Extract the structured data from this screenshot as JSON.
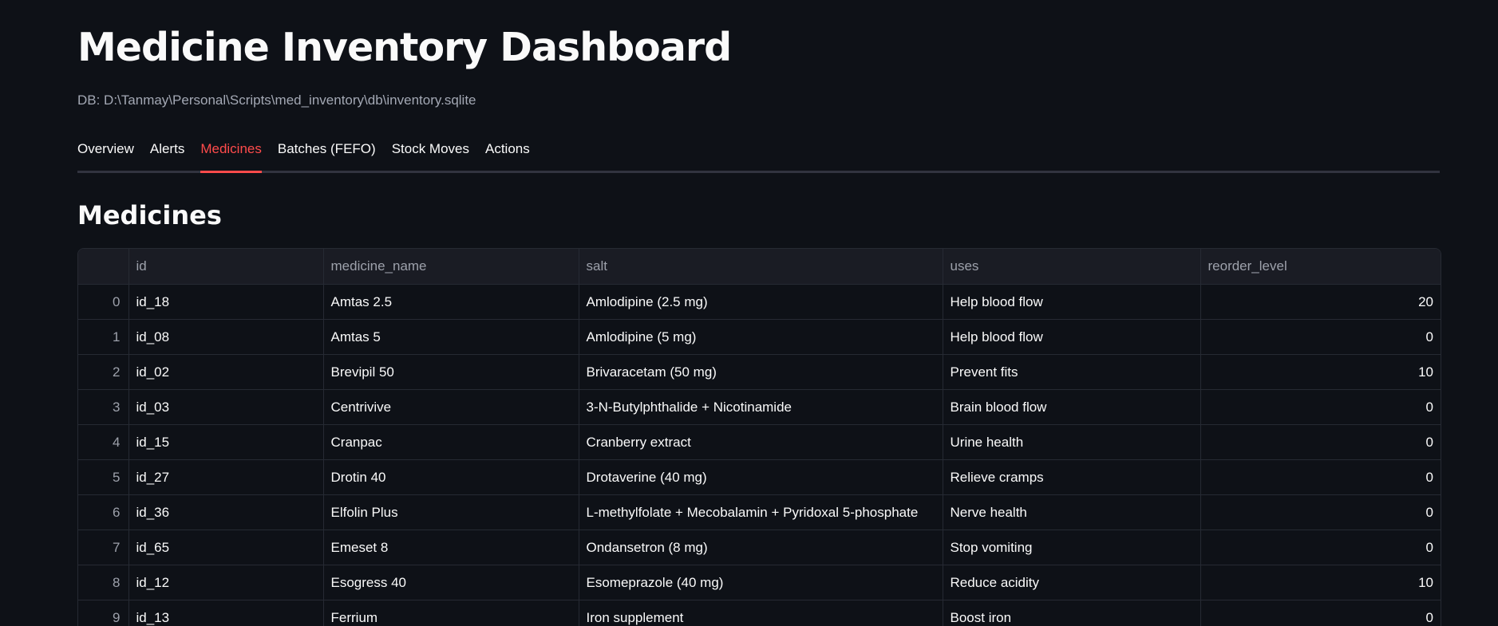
{
  "header": {
    "title": "Medicine Inventory Dashboard",
    "db_caption": "DB: D:\\Tanmay\\Personal\\Scripts\\med_inventory\\db\\inventory.sqlite"
  },
  "tabs": [
    {
      "label": "Overview",
      "active": false
    },
    {
      "label": "Alerts",
      "active": false
    },
    {
      "label": "Medicines",
      "active": true
    },
    {
      "label": "Batches (FEFO)",
      "active": false
    },
    {
      "label": "Stock Moves",
      "active": false
    },
    {
      "label": "Actions",
      "active": false
    }
  ],
  "section": {
    "title": "Medicines"
  },
  "table": {
    "columns": [
      "",
      "id",
      "medicine_name",
      "salt",
      "uses",
      "reorder_level"
    ],
    "rows": [
      {
        "index": "0",
        "id": "id_18",
        "medicine_name": "Amtas 2.5",
        "salt": "Amlodipine (2.5 mg)",
        "uses": "Help blood flow",
        "reorder_level": "20"
      },
      {
        "index": "1",
        "id": "id_08",
        "medicine_name": "Amtas 5",
        "salt": "Amlodipine (5 mg)",
        "uses": "Help blood flow",
        "reorder_level": "0"
      },
      {
        "index": "2",
        "id": "id_02",
        "medicine_name": "Brevipil 50",
        "salt": "Brivaracetam (50 mg)",
        "uses": "Prevent fits",
        "reorder_level": "10"
      },
      {
        "index": "3",
        "id": "id_03",
        "medicine_name": "Centrivive",
        "salt": "3-N-Butylphthalide + Nicotinamide",
        "uses": "Brain blood flow",
        "reorder_level": "0"
      },
      {
        "index": "4",
        "id": "id_15",
        "medicine_name": "Cranpac",
        "salt": "Cranberry extract",
        "uses": "Urine health",
        "reorder_level": "0"
      },
      {
        "index": "5",
        "id": "id_27",
        "medicine_name": "Drotin 40",
        "salt": "Drotaverine (40 mg)",
        "uses": "Relieve cramps",
        "reorder_level": "0"
      },
      {
        "index": "6",
        "id": "id_36",
        "medicine_name": "Elfolin Plus",
        "salt": "L-methylfolate + Mecobalamin + Pyridoxal 5-phosphate",
        "uses": "Nerve health",
        "reorder_level": "0"
      },
      {
        "index": "7",
        "id": "id_65",
        "medicine_name": "Emeset 8",
        "salt": "Ondansetron (8 mg)",
        "uses": "Stop vomiting",
        "reorder_level": "0"
      },
      {
        "index": "8",
        "id": "id_12",
        "medicine_name": "Esogress 40",
        "salt": "Esomeprazole (40 mg)",
        "uses": "Reduce acidity",
        "reorder_level": "10"
      },
      {
        "index": "9",
        "id": "id_13",
        "medicine_name": "Ferrium",
        "salt": "Iron supplement",
        "uses": "Boost iron",
        "reorder_level": "0"
      }
    ]
  },
  "colors": {
    "background": "#0e1117",
    "accent": "#ff4b4b",
    "text": "#fafafa",
    "muted_text": "#a3a8b4"
  }
}
